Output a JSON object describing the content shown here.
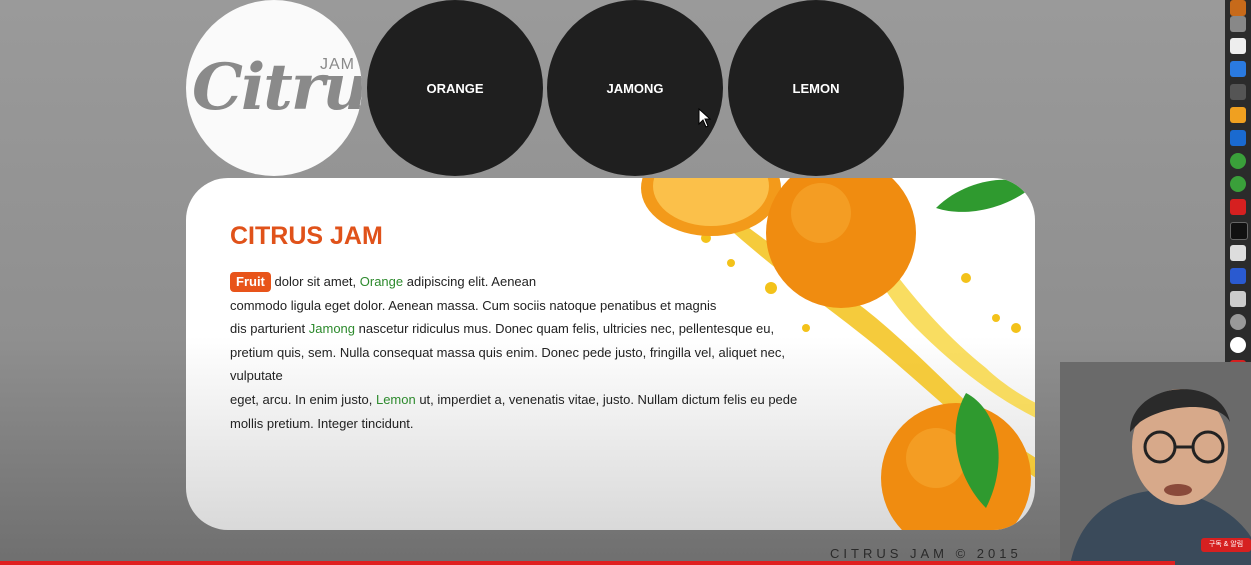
{
  "logo": {
    "word": "Citrus",
    "suffix": "JAM"
  },
  "nav": [
    {
      "label": "ORANGE"
    },
    {
      "label": "JAMONG"
    },
    {
      "label": "LEMON"
    }
  ],
  "content": {
    "title": "CITRUS JAM",
    "badge": "Fruit",
    "text1": " dolor sit amet, ",
    "kw_orange": "Orange",
    "text2": " adipiscing elit. Aenean",
    "text3": "commodo ligula eget dolor. Aenean massa. Cum sociis natoque penatibus et magnis",
    "text4": "dis parturient ",
    "kw_jamong": "Jamong",
    "text5": " nascetur ridiculus mus. Donec quam felis, ultricies nec, pellentesque eu,",
    "text6": "pretium quis, sem. Nulla consequat massa quis enim. Donec pede justo, fringilla vel, aliquet nec, vulputate",
    "text7": "eget, arcu. In enim justo, ",
    "kw_lemon": "Lemon",
    "text8": " ut, imperdiet a, venenatis vitae, justo. Nullam dictum felis eu pede",
    "text9": "mollis pretium. Integer tincidunt."
  },
  "footer": "CITRUS JAM © 2015",
  "yt_badge": "구독 & 알림",
  "colors": {
    "accent": "#e0521a",
    "keyword": "#2d8a2d",
    "nav_bg": "#1f1f1f"
  }
}
